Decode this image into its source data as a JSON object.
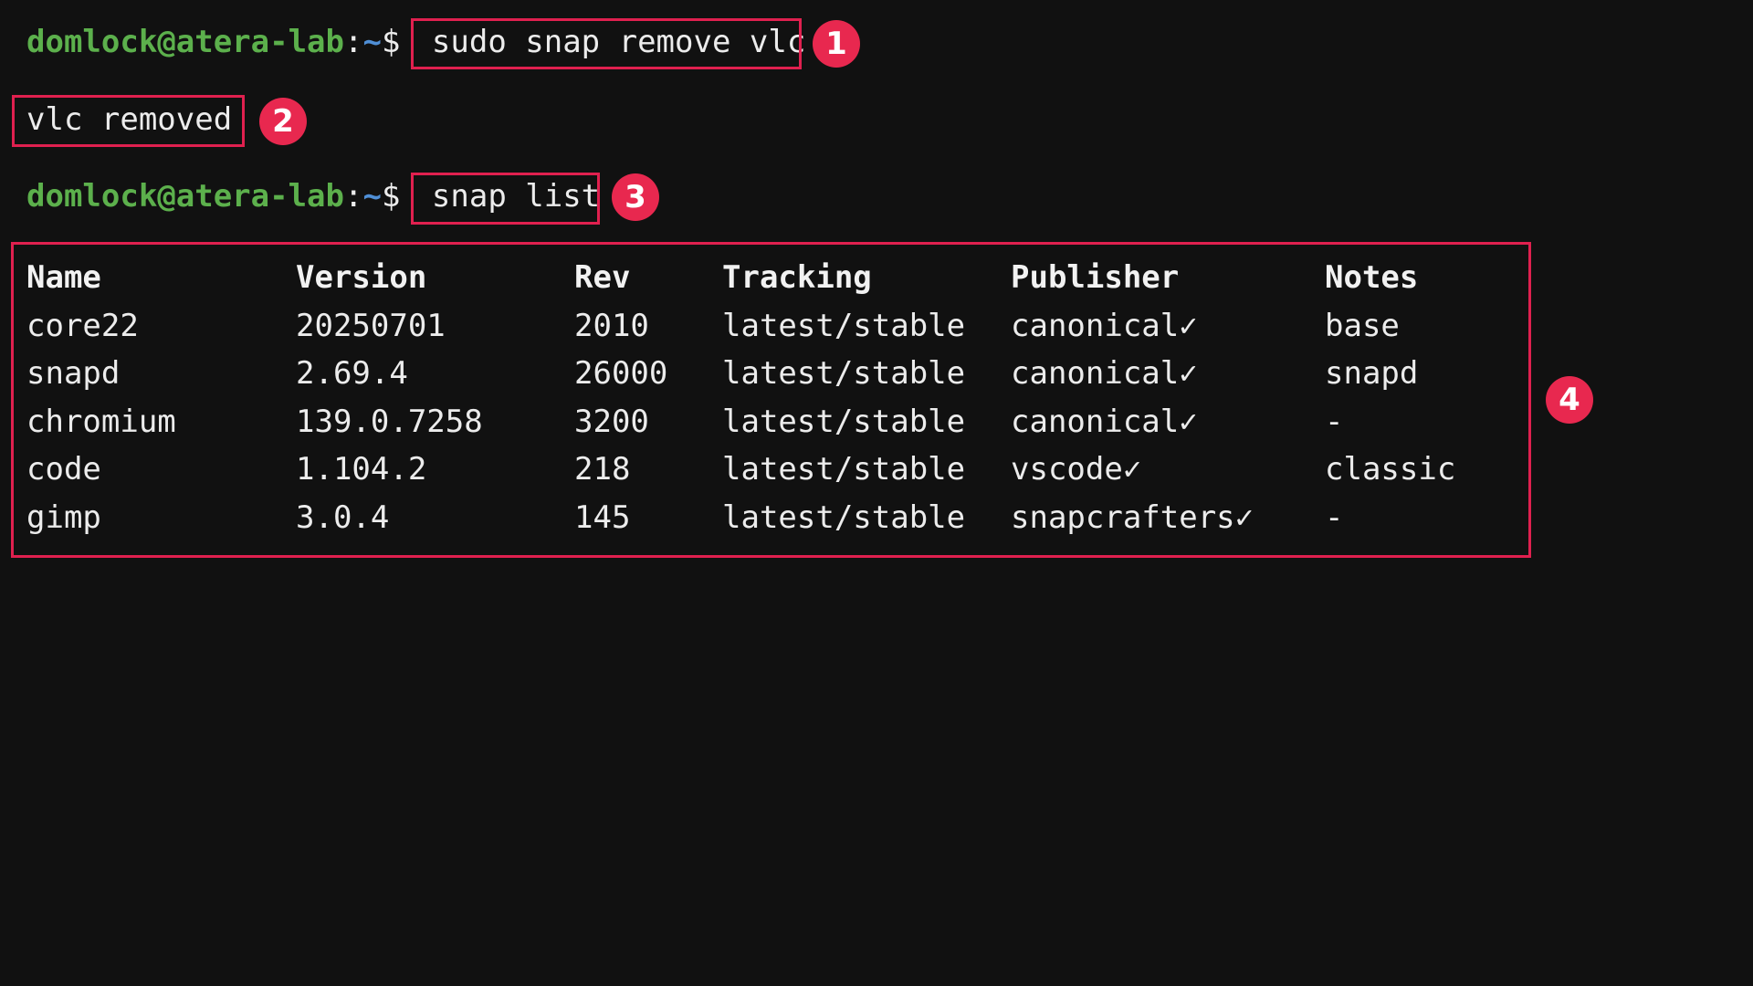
{
  "terminal": {
    "prompt": {
      "user_host": "domlock@atera-lab",
      "separator": ":",
      "path": "~",
      "symbol": "$ "
    },
    "commands": [
      {
        "text": "sudo snap remove vlc",
        "badge": "1"
      },
      {
        "text": "snap list",
        "badge": "3"
      }
    ],
    "output_line": {
      "text": "vlc removed",
      "badge": "2"
    },
    "table_badge": "4",
    "table": {
      "headers": [
        "Name",
        "Version",
        "Rev",
        "Tracking",
        "Publisher",
        "Notes"
      ],
      "rows": [
        [
          "core22",
          "20250701",
          "2010",
          "latest/stable",
          "canonical✓",
          "base"
        ],
        [
          "snapd",
          "2.69.4",
          "26000",
          "latest/stable",
          "canonical✓",
          "snapd"
        ],
        [
          "chromium",
          "139.0.7258",
          "3200",
          "latest/stable",
          "canonical✓",
          "-"
        ],
        [
          "code",
          "1.104.2",
          "218",
          "latest/stable",
          "vscode✓",
          "classic"
        ],
        [
          "gimp",
          "3.0.4",
          "145",
          "latest/stable",
          "snapcrafters✓",
          "-"
        ]
      ]
    }
  },
  "colors": {
    "background": "#111111",
    "prompt_user": "#5cb04c",
    "prompt_path": "#4f8fd6",
    "highlight": "#e0204f",
    "badge": "#e8284f"
  }
}
